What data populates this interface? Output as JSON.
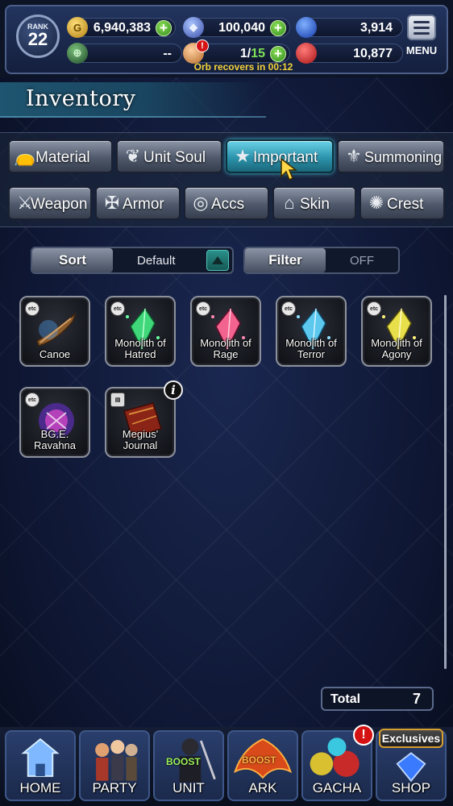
{
  "header": {
    "rank_label": "RANK",
    "rank_value": "22",
    "gold": "6,940,383",
    "crystals": "100,040",
    "blue_orbs": "3,914",
    "green_slot": "--",
    "orb_current": "1",
    "orb_sep": "/",
    "orb_max": "15",
    "red_gems": "10,877",
    "orb_timer": "Orb recovers in 00:12",
    "menu_label": "MENU"
  },
  "title": "Inventory",
  "tabs_row1": [
    {
      "label": "Material",
      "icon": "sack-icon"
    },
    {
      "label": "Unit Soul",
      "icon": "soul-icon"
    },
    {
      "label": "Important",
      "icon": "star-icon",
      "active": true
    },
    {
      "label": "Summoning",
      "icon": "summon-icon"
    }
  ],
  "tabs_row2": [
    {
      "label": "Weapon",
      "icon": "sword-icon"
    },
    {
      "label": "Armor",
      "icon": "armor-icon"
    },
    {
      "label": "Accs",
      "icon": "ring-icon"
    },
    {
      "label": "Skin",
      "icon": "hanger-icon"
    },
    {
      "label": "Crest",
      "icon": "crest-icon"
    }
  ],
  "sort": {
    "label": "Sort",
    "value": "Default"
  },
  "filter": {
    "label": "Filter",
    "value": "OFF"
  },
  "items": [
    {
      "name_1": "Canoe",
      "name_2": "",
      "tag": "etc"
    },
    {
      "name_1": "Monolith of",
      "name_2": "Hatred",
      "tag": "etc"
    },
    {
      "name_1": "Monolith of",
      "name_2": "Rage",
      "tag": "etc"
    },
    {
      "name_1": "Monolith of",
      "name_2": "Terror",
      "tag": "etc"
    },
    {
      "name_1": "Monolith of",
      "name_2": "Agony",
      "tag": "etc"
    },
    {
      "name_1": "BG.E.",
      "name_2": "Ravahna",
      "tag": "etc"
    },
    {
      "name_1": "Megius'",
      "name_2": "Journal",
      "tag": ""
    }
  ],
  "info_glyph": "i",
  "total": {
    "label": "Total",
    "value": "7"
  },
  "nav": [
    {
      "label": "HOME"
    },
    {
      "label": "PARTY"
    },
    {
      "label": "UNIT",
      "boost": "BOOST"
    },
    {
      "label": "ARK",
      "boost": "BOOST"
    },
    {
      "label": "GACHA"
    },
    {
      "label": "SHOP"
    }
  ],
  "exclusives_label": "Exclusives",
  "alert_glyph": "!",
  "colors": {
    "accent_teal": "#2c93ac",
    "header_bg": "#22345e",
    "timer_yellow": "#f4d23a",
    "plus_green": "#2f8a1a"
  }
}
